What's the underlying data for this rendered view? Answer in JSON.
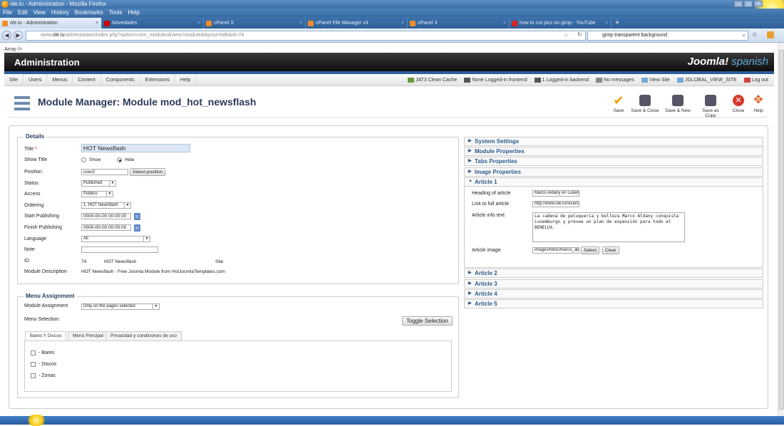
{
  "window": {
    "title": "ole.lu - Administration - Mozilla Firefox"
  },
  "menubar": [
    "File",
    "Edit",
    "View",
    "History",
    "Bookmarks",
    "Tools",
    "Help"
  ],
  "tabs": [
    {
      "label": "ole.lu - Administration",
      "active": true
    },
    {
      "label": "Novedades",
      "active": false
    },
    {
      "label": "cPanel X",
      "active": false
    },
    {
      "label": "cPanel File Manager v3",
      "active": false
    },
    {
      "label": "cPanel X",
      "active": false
    },
    {
      "label": "how to cut pics on gimp - YouTube",
      "active": false
    }
  ],
  "nav": {
    "url_prefix": "www.",
    "url_domain": "ole.lu",
    "url_rest": "/administrator/index.php?option=com_modules&view=module&layout=edit&id=74",
    "search": "gimp transparent background"
  },
  "array_text": "Array />",
  "admin": {
    "title": "Administration",
    "logo": "Joomla!",
    "logo_suffix": "spanish"
  },
  "cpanel_menu": [
    "Site",
    "Users",
    "Menus",
    "Content",
    "Components",
    "Extensions",
    "Help"
  ],
  "status_items": [
    "JAT3 Clean Cache",
    "None Logged-in frontend",
    "1 Logged-in backend",
    "No messages",
    "View Site",
    "JGLOBAL_VIEW_SITE",
    "Log out"
  ],
  "page_title": "Module Manager: Module mod_hot_newsflash",
  "toolbar": {
    "save": "Save",
    "save_close": "Save & Close",
    "save_new": "Save & New",
    "save_copy": "Save as Copy",
    "close": "Close",
    "help": "Help"
  },
  "details": {
    "legend": "Details",
    "title_label": "Title",
    "required_mark": "*",
    "title_value": "HOT Newsflash",
    "show_title_label": "Show Title",
    "show_option": "Show",
    "hide_option": "Hide",
    "show_title_selected": "Hide",
    "position_label": "Position",
    "position_value": "user2",
    "select_position": "Select position",
    "status_label": "Status",
    "status_value": "Published",
    "access_label": "Access",
    "access_value": "Publico",
    "ordering_label": "Ordering",
    "ordering_value": "1. HOT Newsflash",
    "start_label": "Start Publishing",
    "start_value": "0000-00-00 00:00:00",
    "finish_label": "Finish Publishing",
    "finish_value": "0000-00-00 00:00:00",
    "calendar_label": "31",
    "language_label": "Language",
    "language_value": "All",
    "note_label": "Note",
    "note_value": "",
    "id_label": "ID",
    "id_value": "74",
    "id_module": "HOT Newsflash",
    "id_client": "Site",
    "description_label": "Module Description",
    "description_value": "HOT Newsflash - Free Joomla Module from HotJoomlaTemplates.com"
  },
  "menu_assignment": {
    "legend": "Menu Assignment",
    "assignment_label": "Module Assignment",
    "assignment_value": "Only on the pages selected",
    "selection_label": "Menu Selection:",
    "toggle": "Toggle Selection",
    "tabs": [
      "Bares Y Discos",
      "Menú Principal",
      "Privacidad y condiciones de uso"
    ],
    "items": [
      "- Bares",
      "- Discos",
      "- Zonas"
    ]
  },
  "accordion": {
    "closed_top": [
      "System Settings",
      "Module Properties",
      "Tabs Properties",
      "Image Properties"
    ],
    "open_title": "Article 1",
    "heading_label": "Heading of article",
    "heading_value": "Marco Aldany en Luxem",
    "link_label": "Link to full article",
    "link_value": "http://www.ole.lu/recien",
    "info_label": "Article info text",
    "info_value": "La cadena de peluquería y belleza Marco Aldany conquista Luxemburgo y prevee un plan de expansión para todo el BENELUX.",
    "image_label": "Article image",
    "image_value": "images/fotos/marco_ald",
    "select": "Select",
    "clear": "Clear",
    "closed_bottom": [
      "Article 2",
      "Article 3",
      "Article 4",
      "Article 5"
    ]
  },
  "colors": {
    "accent": "#2c5e9e",
    "header_bg": "#1a1a1a",
    "link": "#2a5a8a"
  }
}
